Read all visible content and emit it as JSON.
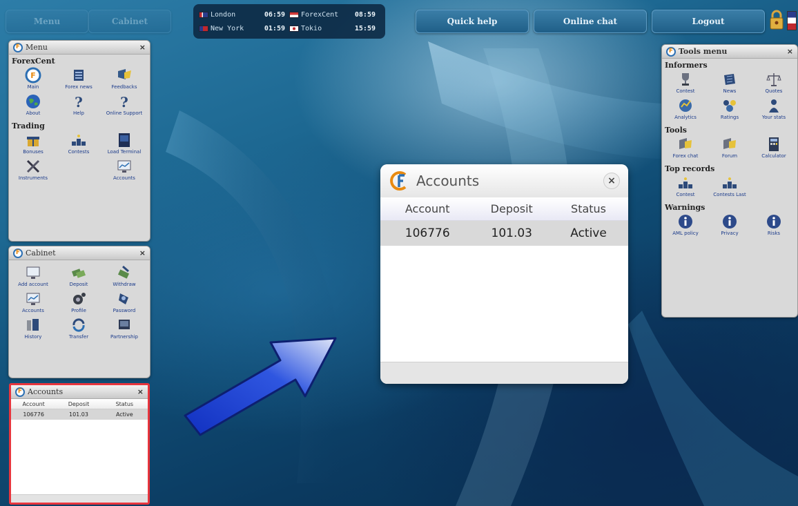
{
  "top_bar": {
    "faded_left": [
      "Menu",
      "Cabinet"
    ],
    "quick_help": "Quick help",
    "online_chat": "Online chat",
    "logout": "Logout"
  },
  "clocks": [
    {
      "city": "London",
      "time": "06:59",
      "flag": "uk-flag"
    },
    {
      "city": "ForexCent",
      "time": "08:59",
      "flag": "forexcent-flag"
    },
    {
      "city": "New York",
      "time": "01:59",
      "flag": "us-flag"
    },
    {
      "city": "Tokio",
      "time": "15:59",
      "flag": "japan-flag"
    }
  ],
  "menu_panel": {
    "title": "Menu",
    "close": "×",
    "sections": [
      {
        "title": "ForexCent",
        "items": [
          {
            "label": "Main",
            "icon": "forexcent-logo-icon"
          },
          {
            "label": "Forex news",
            "icon": "news-icon"
          },
          {
            "label": "Feedbacks",
            "icon": "feedback-icon"
          },
          {
            "label": "About",
            "icon": "globe-icon"
          },
          {
            "label": "Help",
            "icon": "help-icon"
          },
          {
            "label": "Online Support",
            "icon": "support-icon"
          }
        ]
      },
      {
        "title": "Trading",
        "items": [
          {
            "label": "Bonuses",
            "icon": "bonus-icon"
          },
          {
            "label": "Contests",
            "icon": "contest-icon"
          },
          {
            "label": "Load Terminal",
            "icon": "terminal-icon"
          },
          {
            "label": "Instruments",
            "icon": "tools-icon"
          },
          {
            "label": "",
            "icon": "blank"
          },
          {
            "label": "Accounts",
            "icon": "accounts-icon"
          }
        ]
      }
    ]
  },
  "cabinet_panel": {
    "title": "Cabinet",
    "close": "×",
    "items": [
      {
        "label": "Add account",
        "icon": "add-account-icon"
      },
      {
        "label": "Deposit",
        "icon": "deposit-icon"
      },
      {
        "label": "Withdraw",
        "icon": "withdraw-icon"
      },
      {
        "label": "Accounts",
        "icon": "accounts-icon"
      },
      {
        "label": "Profile",
        "icon": "profile-icon"
      },
      {
        "label": "Password",
        "icon": "password-icon"
      },
      {
        "label": "History",
        "icon": "history-icon"
      },
      {
        "label": "Transfer",
        "icon": "transfer-icon"
      },
      {
        "label": "Partnership",
        "icon": "partnership-icon"
      }
    ]
  },
  "tools_panel": {
    "title": "Tools menu",
    "close": "×",
    "sections": [
      {
        "title": "Informers",
        "items": [
          {
            "label": "Contest",
            "icon": "trophy-icon"
          },
          {
            "label": "News",
            "icon": "news-icon"
          },
          {
            "label": "Quotes",
            "icon": "scales-icon"
          },
          {
            "label": "Analytics",
            "icon": "analytics-icon"
          },
          {
            "label": "Ratings",
            "icon": "ratings-icon"
          },
          {
            "label": "Your stats",
            "icon": "stats-icon"
          }
        ]
      },
      {
        "title": "Tools",
        "items": [
          {
            "label": "Forex chat",
            "icon": "chat-icon"
          },
          {
            "label": "Forum",
            "icon": "forum-icon"
          },
          {
            "label": "Calculator",
            "icon": "calculator-icon"
          }
        ]
      },
      {
        "title": "Top records",
        "items": [
          {
            "label": "Contest",
            "icon": "contest-icon"
          },
          {
            "label": "Contests Last",
            "icon": "contest-icon"
          }
        ]
      },
      {
        "title": "Warnings",
        "items": [
          {
            "label": "AML policy",
            "icon": "info-icon"
          },
          {
            "label": "Privacy",
            "icon": "info-icon"
          },
          {
            "label": "Risks",
            "icon": "info-icon"
          }
        ]
      }
    ]
  },
  "accounts": {
    "title": "Accounts",
    "close": "×",
    "columns": [
      "Account",
      "Deposit",
      "Status"
    ],
    "rows": [
      [
        "106776",
        "101.03",
        "Active"
      ]
    ]
  },
  "colors": {
    "highlight": "#e8353d",
    "arrow": "#1a3fd1",
    "logo_blue": "#2c6fb3",
    "logo_orange": "#e88a10"
  }
}
